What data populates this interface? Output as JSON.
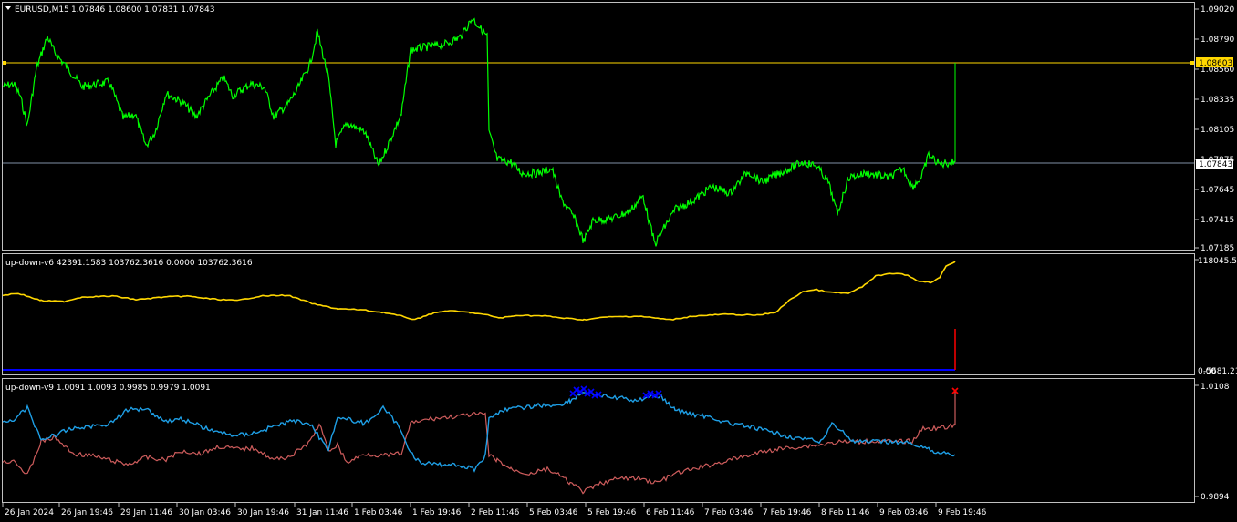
{
  "window": {
    "symbol_label": "EURUSD,M15",
    "ohlc_label": "1.07846 1.08600 1.07831 1.07843"
  },
  "main_panel": {
    "y_labels": [
      "1.09020",
      "1.08790",
      "1.08560",
      "1.08335",
      "1.08105",
      "1.07875",
      "1.07645",
      "1.07415",
      "1.07185"
    ],
    "price_tag": "1.07843",
    "hline_tag": "1.08603",
    "colors": {
      "price": "#00ff00",
      "hline": "#ffd700",
      "bid_line": "#7f8fa6"
    }
  },
  "indicator1": {
    "label": "up-down-v6 42391.1583 103762.3616 0.0000 103762.3616",
    "y_top": "118045.50",
    "y_bottom": "-5681.214",
    "y_bottom_overlap": "0.00",
    "colors": {
      "line": "#ffd700",
      "base": "#0000ff",
      "spike": "#ff0000"
    }
  },
  "indicator2": {
    "label": "up-down-v9 1.0091 1.0093 0.9985 0.9979 1.0091",
    "y_top": "1.0108",
    "y_bottom": "0.9894",
    "colors": {
      "blue": "#1e9fe6",
      "red": "#cd5c5c",
      "marker_blue": "#0000ff",
      "marker_red": "#ff0000"
    }
  },
  "time_axis": {
    "labels": [
      "26 Jan 2024",
      "26 Jan 19:46",
      "29 Jan 11:46",
      "30 Jan 03:46",
      "30 Jan 19:46",
      "31 Jan 11:46",
      "1 Feb 03:46",
      "1 Feb 19:46",
      "2 Feb 11:46",
      "5 Feb 03:46",
      "5 Feb 19:46",
      "6 Feb 11:46",
      "7 Feb 03:46",
      "7 Feb 19:46",
      "8 Feb 11:46",
      "9 Feb 03:46",
      "9 Feb 19:46"
    ]
  }
}
